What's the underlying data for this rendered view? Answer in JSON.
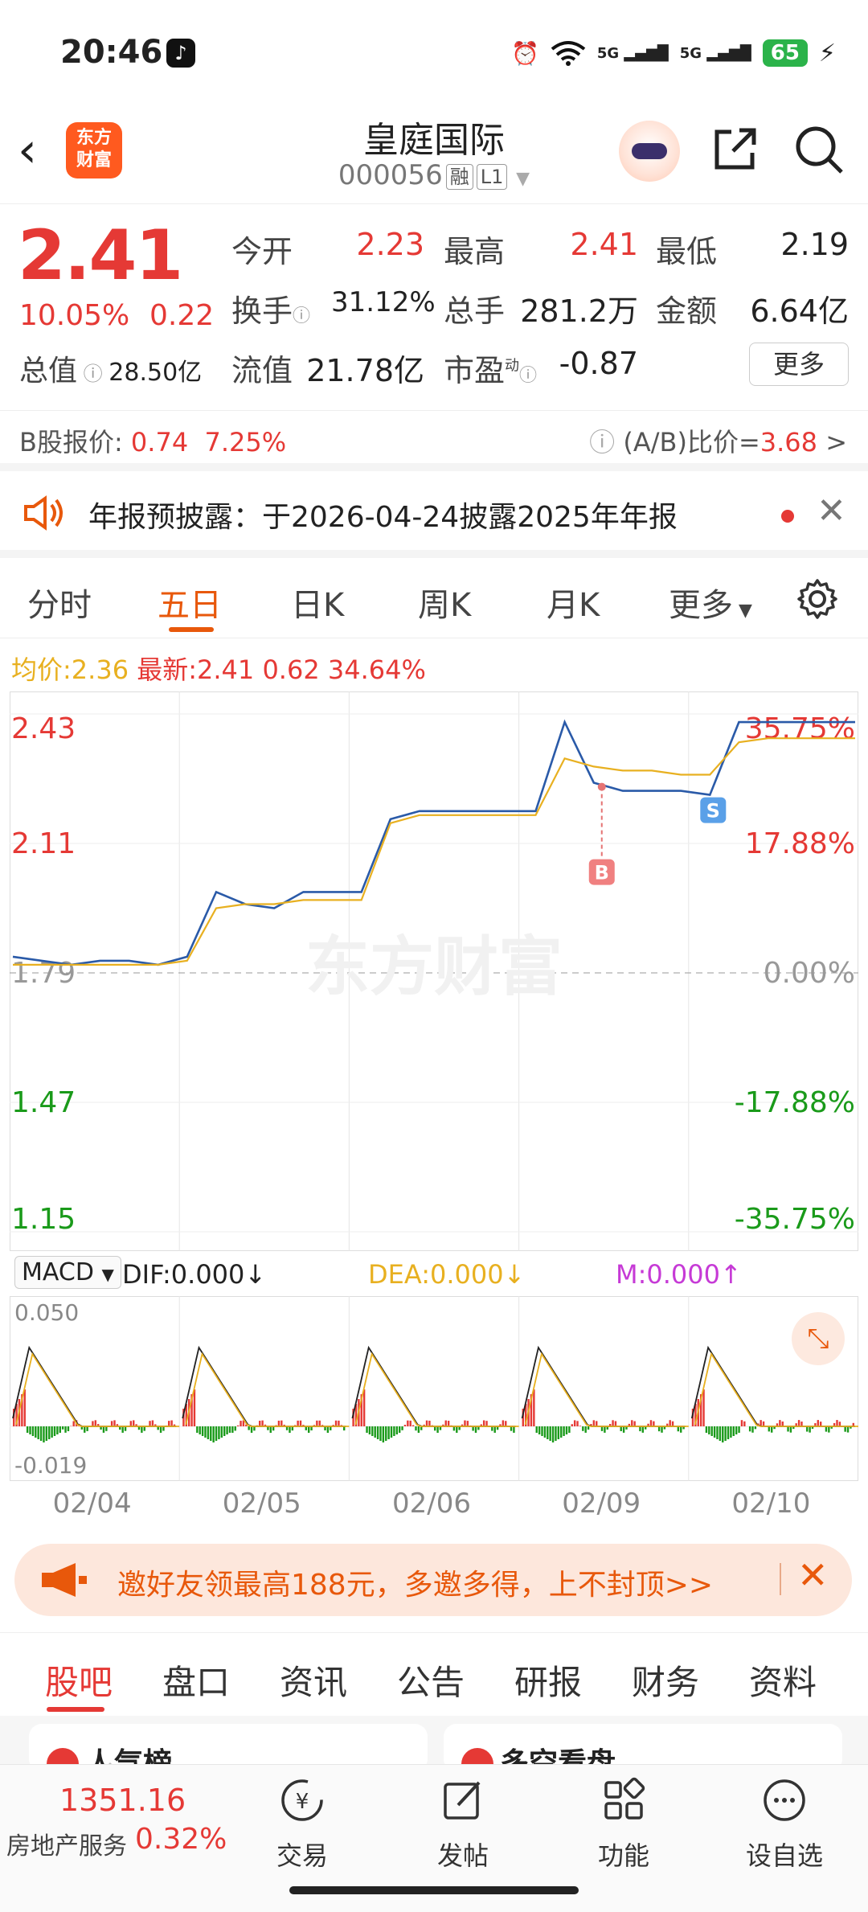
{
  "status_bar": {
    "time": "20:46",
    "net_1": "5G",
    "net_2": "5G",
    "battery": "65"
  },
  "header": {
    "logo_text": "东方财富",
    "stock_name": "皇庭国际",
    "stock_code": "000056",
    "tag_1": "融",
    "tag_2": "L1"
  },
  "quote": {
    "price": "2.41",
    "change_pct": "10.05%",
    "change_amt": "0.22",
    "total_value_label": "总值",
    "total_value": "28.50亿",
    "open_label": "今开",
    "open": "2.23",
    "high_label": "最高",
    "high": "2.41",
    "low_label": "最低",
    "low": "2.19",
    "turnover_label": "换手",
    "turnover": "31.12%",
    "volume_label": "总手",
    "volume": "281.2万",
    "amount_label": "金额",
    "amount": "6.64亿",
    "float_label": "流值",
    "float_value": "21.78亿",
    "pe_label": "市盈",
    "pe_sup": "动",
    "pe": "-0.87",
    "more": "更多"
  },
  "b_share": {
    "label": "B股报价:",
    "price": "0.74",
    "pct": "7.25%",
    "ratio_label": "(A/B)比价=",
    "ratio": "3.68",
    "arrow": ">"
  },
  "notice": {
    "text": "年报预披露：于2026-04-24披露2025年年报"
  },
  "tabs": [
    "分时",
    "五日",
    "日K",
    "周K",
    "月K",
    "更多"
  ],
  "avg_line": {
    "avg_label": "均价:",
    "avg": "2.36",
    "latest_label": "最新:",
    "latest": "2.41",
    "chg": "0.62",
    "pct": "34.64%"
  },
  "chart_data": {
    "type": "line",
    "title": "",
    "x": [
      "02/04",
      "02/05",
      "02/06",
      "02/09",
      "02/10"
    ],
    "y_left_ticks": [
      "2.43",
      "2.11",
      "1.79",
      "1.47",
      "1.15"
    ],
    "y_right_ticks": [
      "35.75%",
      "17.88%",
      "0.00%",
      "-17.88%",
      "-35.75%"
    ],
    "ylim": [
      1.15,
      2.43
    ],
    "prev_close": 1.79,
    "series": [
      {
        "name": "",
        "color": "#2a5aa8",
        "values": [
          1.83,
          1.82,
          1.81,
          1.82,
          1.82,
          1.81,
          1.83,
          1.99,
          1.96,
          1.95,
          1.99,
          1.99,
          1.99,
          2.17,
          2.19,
          2.19,
          2.19,
          2.19,
          2.19,
          2.41,
          2.26,
          2.24,
          2.24,
          2.24,
          2.23,
          2.41,
          2.41,
          2.41,
          2.41,
          2.41
        ]
      },
      {
        "name": "",
        "color": "#e8b020",
        "values": [
          1.81,
          1.81,
          1.81,
          1.81,
          1.81,
          1.81,
          1.82,
          1.95,
          1.96,
          1.96,
          1.97,
          1.97,
          1.97,
          2.16,
          2.18,
          2.18,
          2.18,
          2.18,
          2.18,
          2.32,
          2.3,
          2.29,
          2.29,
          2.28,
          2.28,
          2.36,
          2.37,
          2.37,
          2.37,
          2.37
        ]
      }
    ],
    "markers": [
      {
        "label": "B",
        "value": 2.25
      },
      {
        "label": "S",
        "value": 2.24
      }
    ],
    "watermark": "东方财富"
  },
  "macd": {
    "selector": "MACD",
    "dif": "DIF:0.000",
    "dea": "DEA:0.000",
    "m": "M:0.000",
    "top": "0.050",
    "bottom": "-0.019"
  },
  "banner": {
    "text": "邀好友领最高188元，多邀多得，上不封顶>>"
  },
  "bottom_tabs": [
    "股吧",
    "盘口",
    "资讯",
    "公告",
    "研报",
    "财务",
    "资料"
  ],
  "cards": [
    "人气榜",
    "多空看盘"
  ],
  "bottom_nav": {
    "index_value": "1351.16",
    "index_name": "房地产服务",
    "index_pct": "0.32%",
    "items": [
      "交易",
      "发帖",
      "功能",
      "设自选"
    ]
  }
}
